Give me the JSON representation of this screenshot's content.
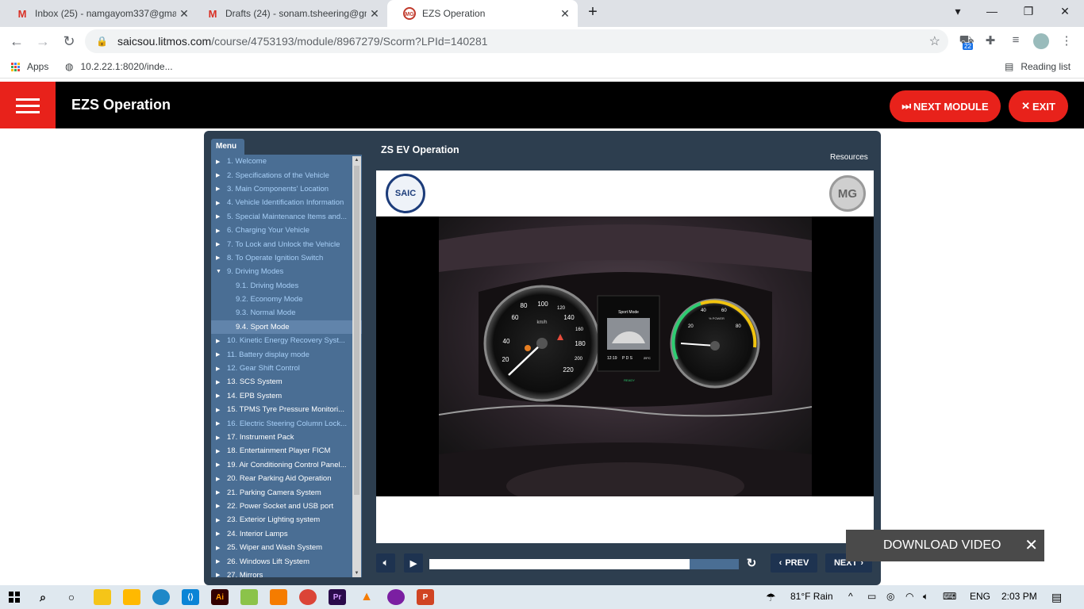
{
  "browser": {
    "tabs": [
      {
        "title": "Inbox (25) - namgayom337@gmail.com",
        "icon": "gmail-icon"
      },
      {
        "title": "Drafts (24) - sonam.tsheering@gmail.com",
        "icon": "gmail-icon"
      },
      {
        "title": "EZS Operation",
        "icon": "mg-icon"
      }
    ],
    "url_host": "saicsou.litmos.com",
    "url_path": "/course/4753193/module/8967279/Scorm?LPId=140281",
    "extension_badge": "22",
    "bookmarks": {
      "apps": "Apps",
      "link": "10.2.22.1:8020/inde...",
      "reading_list": "Reading list"
    }
  },
  "app": {
    "title": "EZS Operation",
    "next_module": "NEXT MODULE",
    "exit": "EXIT"
  },
  "course": {
    "menu_label": "Menu",
    "title": "ZS EV Operation",
    "resources": "Resources",
    "menu": [
      {
        "label": "1. Welcome",
        "kind": "top",
        "color": "blue"
      },
      {
        "label": "2. Specifications of the Vehicle",
        "kind": "top",
        "color": "blue"
      },
      {
        "label": "3. Main Components' Location",
        "kind": "top",
        "color": "blue"
      },
      {
        "label": "4. Vehicle Identification Information",
        "kind": "top",
        "color": "blue"
      },
      {
        "label": "5. Special Maintenance Items and...",
        "kind": "top",
        "color": "blue"
      },
      {
        "label": "6. Charging Your Vehicle",
        "kind": "top",
        "color": "blue"
      },
      {
        "label": "7. To Lock and Unlock the Vehicle",
        "kind": "top",
        "color": "blue"
      },
      {
        "label": "8. To Operate Ignition Switch",
        "kind": "top",
        "color": "blue"
      },
      {
        "label": "9. Driving Modes",
        "kind": "open",
        "color": "blue"
      },
      {
        "label": "9.1. Driving Modes",
        "kind": "sub",
        "color": "blue"
      },
      {
        "label": "9.2. Economy Mode",
        "kind": "sub",
        "color": "blue"
      },
      {
        "label": "9.3. Normal Mode",
        "kind": "sub",
        "color": "blue"
      },
      {
        "label": "9.4. Sport Mode",
        "kind": "sub",
        "color": "selected"
      },
      {
        "label": "10. Kinetic Energy Recovery Syst...",
        "kind": "top",
        "color": "blue"
      },
      {
        "label": "11. Battery display mode",
        "kind": "top",
        "color": "blue"
      },
      {
        "label": "12. Gear Shift Control",
        "kind": "top",
        "color": "blue"
      },
      {
        "label": "13. SCS System",
        "kind": "top",
        "color": "white"
      },
      {
        "label": "14. EPB System",
        "kind": "top",
        "color": "white"
      },
      {
        "label": "15. TPMS Tyre Pressure Monitori...",
        "kind": "top",
        "color": "white"
      },
      {
        "label": "16. Electric Steering Column Lock...",
        "kind": "top",
        "color": "blue"
      },
      {
        "label": "17. Instrument Pack",
        "kind": "top",
        "color": "white"
      },
      {
        "label": "18. Entertainment Player FICM",
        "kind": "top",
        "color": "white"
      },
      {
        "label": "19. Air Conditioning Control Panel...",
        "kind": "top",
        "color": "white"
      },
      {
        "label": "20. Rear Parking Aid Operation",
        "kind": "top",
        "color": "white"
      },
      {
        "label": "21. Parking Camera System",
        "kind": "top",
        "color": "white"
      },
      {
        "label": "22. Power Socket and USB port",
        "kind": "top",
        "color": "white"
      },
      {
        "label": "23. Exterior Lighting system",
        "kind": "top",
        "color": "white"
      },
      {
        "label": "24. Interior Lamps",
        "kind": "top",
        "color": "white"
      },
      {
        "label": "25. Wiper and Wash System",
        "kind": "top",
        "color": "white"
      },
      {
        "label": "26. Windows Lift System",
        "kind": "top",
        "color": "white"
      },
      {
        "label": "27. Mirrors",
        "kind": "top",
        "color": "white"
      }
    ],
    "logos": {
      "left": "SAIC",
      "right": "MG"
    },
    "video": {
      "progress": 0.84,
      "dash_mode_title": "Sport Mode",
      "dash_time": "12:19",
      "dash_gear": "P D S",
      "dash_temp": "25°C",
      "dash_ready": "READY",
      "speed_ticks": [
        "20",
        "40",
        "60",
        "80",
        "100",
        "120",
        "140",
        "160",
        "180",
        "200",
        "220"
      ],
      "speed_unit": "km/h",
      "power_ticks": [
        "20",
        "40",
        "60",
        "80"
      ],
      "power_unit": "% POWER"
    },
    "prev": "PREV",
    "next": "NEXT"
  },
  "download_bar": {
    "label": "DOWNLOAD VIDEO"
  },
  "taskbar": {
    "weather": "81°F  Rain",
    "lang": "ENG",
    "time": "2:03 PM"
  },
  "colors": {
    "accent_red": "#e8221b",
    "player_bg": "#2d3e4f",
    "menu_bg": "#4a6e94"
  }
}
